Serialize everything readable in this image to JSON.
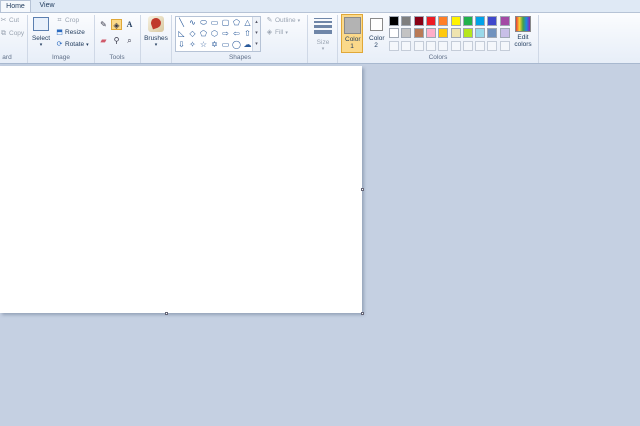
{
  "tabs": [
    {
      "label": "Home",
      "active": true
    },
    {
      "label": "View",
      "active": false
    }
  ],
  "clipboard": {
    "cut_label": "Cut",
    "copy_label": "Copy",
    "group_label": "ard"
  },
  "image": {
    "select_label": "Select",
    "crop_label": "Crop",
    "resize_label": "Resize",
    "rotate_label": "Rotate",
    "group_label": "Image"
  },
  "tools": {
    "group_label": "Tools",
    "items": [
      "pencil-icon",
      "fill-bucket-icon",
      "text-icon",
      "eraser-icon",
      "color-picker-icon",
      "magnifier-icon"
    ],
    "selected": "fill-bucket-icon"
  },
  "brushes": {
    "label": "Brushes"
  },
  "shapes": {
    "group_label": "Shapes",
    "outline_label": "Outline",
    "fill_label": "Fill"
  },
  "size": {
    "label": "Size"
  },
  "colors": {
    "group_label": "Colors",
    "color1_label": "Color 1",
    "color2_label": "Color 2",
    "color1_value": "#b3b3b3",
    "color2_value": "#ffffff",
    "edit_label": "Edit colors",
    "palette_row1": [
      "#000000",
      "#7f7f7f",
      "#880015",
      "#ed1c24",
      "#ff7f27",
      "#fff200",
      "#22b14c",
      "#00a2e8",
      "#3f48cc",
      "#a349a4"
    ],
    "palette_row2": [
      "#ffffff",
      "#c3c3c3",
      "#b97a57",
      "#ffaec9",
      "#ffc90e",
      "#efe4b0",
      "#b5e61d",
      "#99d9ea",
      "#7092be",
      "#c8bfe7"
    ]
  }
}
